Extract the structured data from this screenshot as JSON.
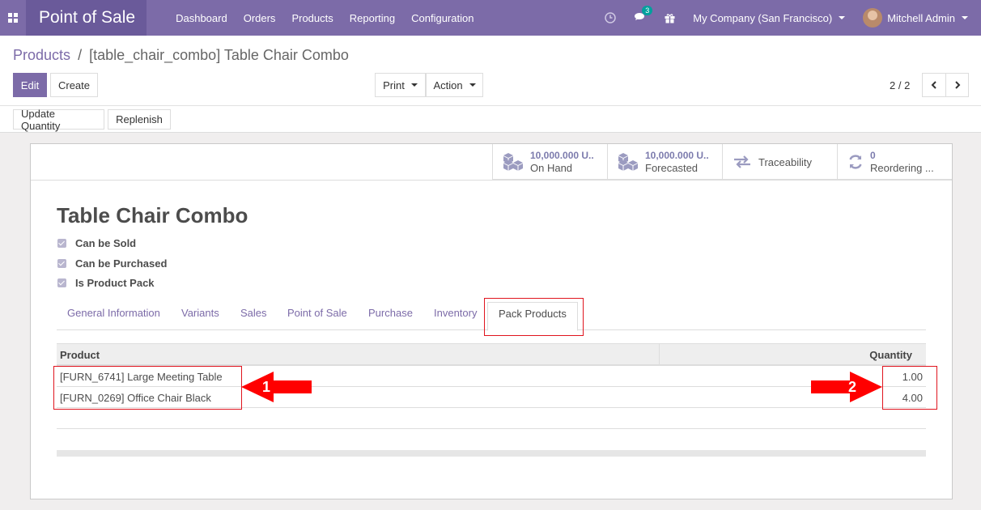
{
  "navbar": {
    "app_name": "Point of Sale",
    "menu": [
      "Dashboard",
      "Orders",
      "Products",
      "Reporting",
      "Configuration"
    ],
    "message_count": "3",
    "company": "My Company (San Francisco)",
    "user": "Mitchell Admin"
  },
  "breadcrumb": {
    "parent": "Products",
    "separator": "/",
    "current": "[table_chair_combo] Table Chair Combo"
  },
  "buttons": {
    "edit": "Edit",
    "create": "Create",
    "print": "Print",
    "action": "Action",
    "update_quantity": "Update Quantity",
    "replenish": "Replenish"
  },
  "pager": "2 / 2",
  "stats": [
    {
      "value": "10,000.000 U..",
      "label": "On Hand"
    },
    {
      "value": "10,000.000 U..",
      "label": "Forecasted"
    },
    {
      "value": "",
      "label": "Traceability"
    },
    {
      "value": "0",
      "label": "Reordering ..."
    }
  ],
  "product": {
    "name": "Table Chair Combo",
    "checkboxes": [
      "Can be Sold",
      "Can be Purchased",
      "Is Product Pack"
    ]
  },
  "tabs": [
    "General Information",
    "Variants",
    "Sales",
    "Point of Sale",
    "Purchase",
    "Inventory",
    "Pack Products"
  ],
  "table": {
    "headers": [
      "Product",
      "Quantity"
    ],
    "rows": [
      {
        "product": "[FURN_6741] Large Meeting Table",
        "quantity": "1.00"
      },
      {
        "product": "[FURN_0269] Office Chair Black",
        "quantity": "4.00"
      }
    ]
  },
  "annotations": [
    "1",
    "2"
  ],
  "colors": {
    "brand": "#7c6ba8",
    "highlight": "#e0141e"
  }
}
